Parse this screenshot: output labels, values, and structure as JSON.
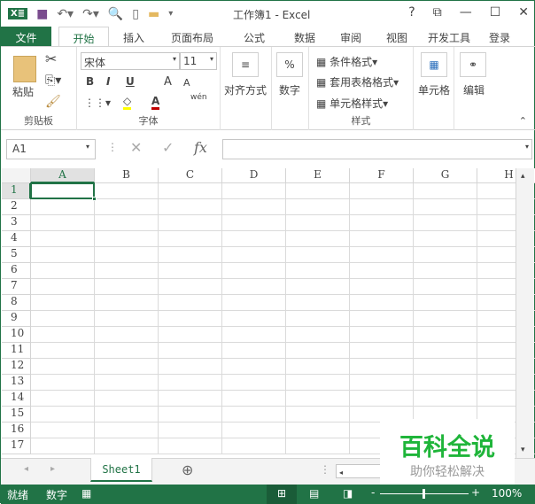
{
  "title": {
    "text": "工作簿1 - Excel",
    "help": "?",
    "restore": "⧉",
    "minimize": "—",
    "maximize": "☐",
    "close": "✕"
  },
  "tabs": [
    "文件",
    "开始",
    "插入",
    "页面布局",
    "公式",
    "数据",
    "审阅",
    "视图",
    "开发工具",
    "登录"
  ],
  "ribbon": {
    "clipboard": {
      "paste": "粘贴",
      "label": "剪贴板"
    },
    "font": {
      "name": "宋体",
      "size": "11",
      "bold": "B",
      "italic": "I",
      "underline": "U",
      "grow": "A",
      "shrink": "A",
      "font_color": "A",
      "phonetic": "wén",
      "label": "字体"
    },
    "alignment": {
      "label": "对齐方式"
    },
    "number": {
      "symbol": "%",
      "label": "数字"
    },
    "styles": {
      "conditional": "条件格式",
      "table": "套用表格格式",
      "cell_styles": "单元格样式",
      "label": "样式"
    },
    "cells": {
      "label": "单元格"
    },
    "editing": {
      "label": "编辑"
    }
  },
  "formula_bar": {
    "name_box": "A1",
    "fx": "fx",
    "value": ""
  },
  "grid": {
    "columns": [
      "A",
      "B",
      "C",
      "D",
      "E",
      "F",
      "G",
      "H"
    ],
    "rows": [
      "1",
      "2",
      "3",
      "4",
      "5",
      "6",
      "7",
      "8",
      "9",
      "10",
      "11",
      "12",
      "13",
      "14",
      "15",
      "16",
      "17"
    ],
    "selected": "A1"
  },
  "sheets": [
    "Sheet1"
  ],
  "status": {
    "ready": "就绪",
    "mode": "数字",
    "zoom": "100%"
  },
  "watermark": {
    "title": "百科全说",
    "subtitle": "助你轻松解决"
  },
  "colors": {
    "accent": "#217346",
    "watermark": "#1fb53a"
  }
}
